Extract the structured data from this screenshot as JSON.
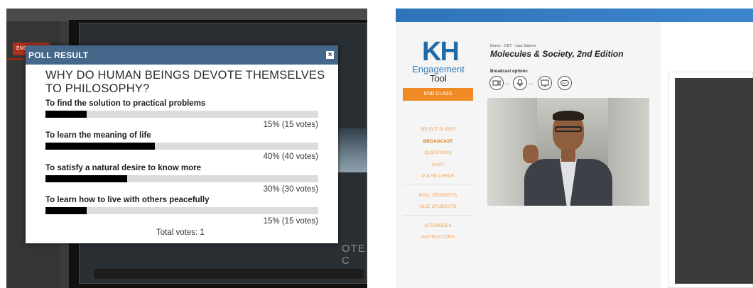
{
  "poll": {
    "header_title": "POLL RESULT",
    "close_icon": "×",
    "question": "WHY DO HUMAN BEINGS DEVOTE THEMSELVES TO PHILOSOPHY?",
    "answers": [
      {
        "label": "To find the solution to practical problems",
        "result": "15% (15 votes)",
        "percent": 15
      },
      {
        "label": "To learn the meaning of life",
        "result": "40% (40 votes)",
        "percent": 40
      },
      {
        "label": "To satisfy a natural desire to know more",
        "result": "30% (30 votes)",
        "percent": 30
      },
      {
        "label": "To learn how to live with others peacefully",
        "result": "15% (15 votes)",
        "percent": 15
      }
    ],
    "total_votes": "Total votes: 1"
  },
  "left_app": {
    "end_class_label": "END CLASS",
    "background_slide_text": "OTE C"
  },
  "right_app": {
    "logo_kh": "KH",
    "logo_engagement": "Engagement",
    "logo_tool": "Tool",
    "end_class_label": "END CLASS",
    "nav": {
      "select_slides": "SELECT SLIDES",
      "broadcast": "BROADCAST",
      "questions": "QUESTIONS",
      "chat": "CHAT",
      "pulse_check": "PULSE CHECK",
      "poll_students": "POLL STUDENTS",
      "quiz_students": "QUIZ STUDENTS",
      "attendees": "ATTENDEES",
      "instructors": "INSTRUCTORS"
    },
    "course_subtitle": "Demo - CET - Lisa Sabers",
    "course_title": "Molecules & Society, 2nd Edition",
    "broadcast_label": "Broadcast options",
    "rec_label": "REC",
    "icons": {
      "camera": "video-camera-icon",
      "mic": "microphone-icon",
      "screen": "screen-share-icon",
      "rec": "record-icon"
    }
  },
  "colors": {
    "poll_header": "#45688a",
    "bar_fill": "#000000",
    "bar_track": "#dcdcdc",
    "end_class_orange": "#f08a24",
    "nav_orange": "#f0a050",
    "brand_blue": "#1f6aa8",
    "top_bar_blue": "#2f74b8"
  }
}
